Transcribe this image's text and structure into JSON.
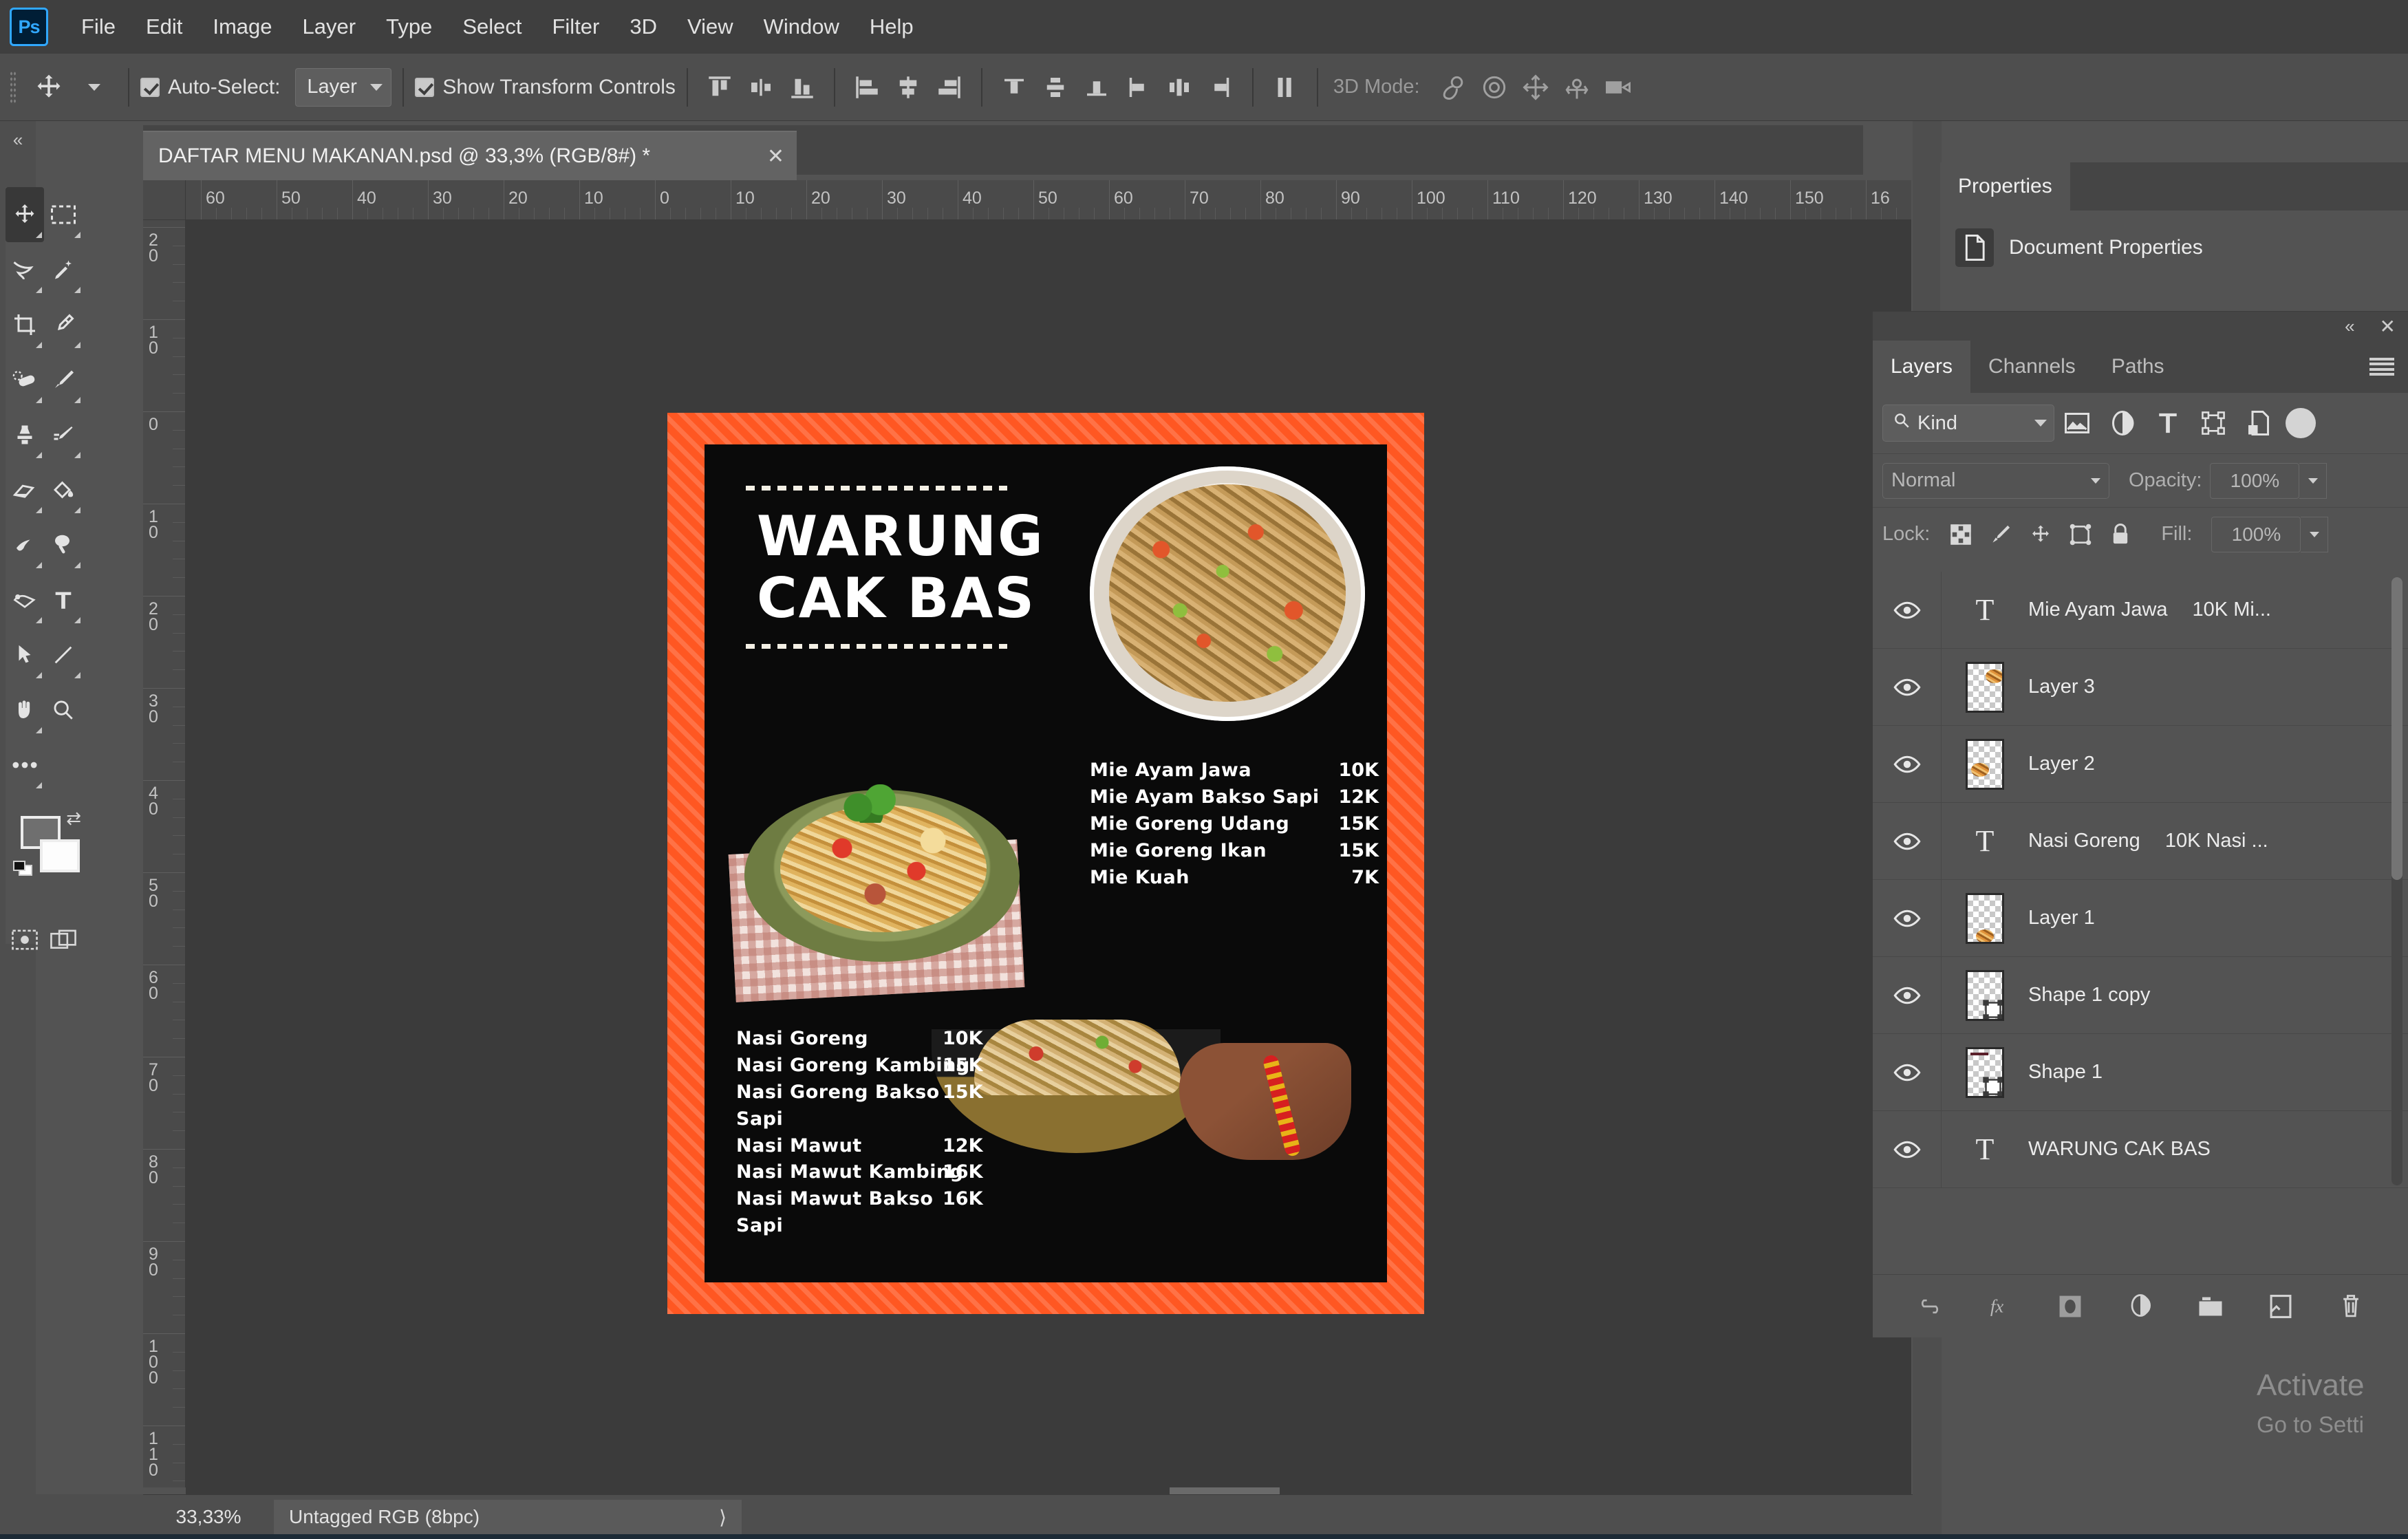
{
  "app": {
    "logo_label": "Ps",
    "menus": [
      "File",
      "Edit",
      "Image",
      "Layer",
      "Type",
      "Select",
      "Filter",
      "3D",
      "View",
      "Window",
      "Help"
    ]
  },
  "options_bar": {
    "auto_select_label": "Auto-Select:",
    "auto_select_checked": true,
    "auto_select_target": "Layer",
    "show_transform_label": "Show Transform Controls",
    "show_transform_checked": true,
    "mode3d_label": "3D Mode:",
    "align_icons": [
      "align-top-edges-icon",
      "align-vertical-centers-icon",
      "align-bottom-edges-icon",
      "align-left-edges-icon",
      "align-horizontal-centers-icon",
      "align-right-edges-icon",
      "distribute-top-edges-icon",
      "distribute-vertical-centers-icon",
      "distribute-bottom-edges-icon",
      "distribute-left-edges-icon",
      "distribute-horizontal-centers-icon",
      "distribute-right-edges-icon",
      "distribute-spacing-icon"
    ],
    "mode3d_icons": [
      "orbit-3d-icon",
      "roll-3d-icon",
      "pan-3d-icon",
      "slide-3d-icon",
      "scale-3d-icon"
    ]
  },
  "document_tab": {
    "title": "DAFTAR MENU MAKANAN.psd @ 33,3% (RGB/8#) *",
    "close_glyph": "✕"
  },
  "rulers": {
    "unit_note": "",
    "horizontal_labels": [
      "60",
      "50",
      "40",
      "30",
      "20",
      "10",
      "0",
      "10",
      "20",
      "30",
      "40",
      "50",
      "60",
      "70",
      "80",
      "90",
      "100",
      "110",
      "120",
      "130",
      "140",
      "150",
      "16"
    ],
    "vertical_labels": [
      "20",
      "10",
      "0",
      "10",
      "20",
      "30",
      "40",
      "50",
      "60",
      "70",
      "80",
      "90",
      "100",
      "110"
    ]
  },
  "toolbar": {
    "tools": [
      {
        "name": "move-tool",
        "glyph": "✛",
        "selected": true
      },
      {
        "name": "rectangular-marquee-tool",
        "glyph": "⬚",
        "selected": false
      },
      {
        "name": "lasso-tool",
        "glyph": "⧉",
        "selected": false
      },
      {
        "name": "quick-selection-tool",
        "glyph": "✨",
        "selected": false
      },
      {
        "name": "crop-tool",
        "glyph": "⬒",
        "selected": false
      },
      {
        "name": "eyedropper-tool",
        "glyph": "✐",
        "selected": false
      },
      {
        "name": "spot-healing-brush-tool",
        "glyph": "⚕",
        "selected": false
      },
      {
        "name": "brush-tool",
        "glyph": "✎",
        "selected": false
      },
      {
        "name": "clone-stamp-tool",
        "glyph": "⚑",
        "selected": false
      },
      {
        "name": "history-brush-tool",
        "glyph": "✒",
        "selected": false
      },
      {
        "name": "eraser-tool",
        "glyph": "▱",
        "selected": false
      },
      {
        "name": "paint-bucket-tool",
        "glyph": "◈",
        "selected": false
      },
      {
        "name": "blur-tool",
        "glyph": "☞",
        "selected": false
      },
      {
        "name": "dodge-tool",
        "glyph": "⚲",
        "selected": false
      },
      {
        "name": "pen-tool",
        "glyph": "✒",
        "selected": false
      },
      {
        "name": "horizontal-type-tool",
        "glyph": "T",
        "selected": false
      },
      {
        "name": "path-selection-tool",
        "glyph": "➤",
        "selected": false
      },
      {
        "name": "line-tool",
        "glyph": "╱",
        "selected": false
      },
      {
        "name": "hand-tool",
        "glyph": "✋",
        "selected": false
      },
      {
        "name": "zoom-tool",
        "glyph": "⚲",
        "selected": false
      },
      {
        "name": "edit-toolbar-tool",
        "glyph": "•••",
        "selected": false
      }
    ],
    "foreground_color": "#6f6f6f",
    "background_color": "#fdfdfd",
    "swap_colors_icon": "swap-colors-icon",
    "default_colors_icon": "default-colors-icon",
    "quick_mask_icon": "quick-mask-mode-icon",
    "screen_mode_icon": "screen-mode-icon"
  },
  "canvas": {
    "poster": {
      "border_color": "#ff5722",
      "background_color": "#0a0a0a",
      "brand_name": "WARUNG\nCAK BAS",
      "mie_items": [
        {
          "name": "Mie Ayam Jawa",
          "price": "10K"
        },
        {
          "name": "Mie Ayam Bakso Sapi",
          "price": "12K"
        },
        {
          "name": "Mie Goreng Udang",
          "price": "15K"
        },
        {
          "name": "Mie Goreng Ikan",
          "price": "15K"
        },
        {
          "name": "Mie Kuah",
          "price": "7K"
        }
      ],
      "nasi_items": [
        {
          "name": "Nasi Goreng",
          "price": "10K"
        },
        {
          "name": "Nasi Goreng Kambing",
          "price": "15K"
        },
        {
          "name": "Nasi Goreng Bakso Sapi",
          "price": "15K"
        },
        {
          "name": "Nasi Mawut",
          "price": "12K"
        },
        {
          "name": "Nasi Mawut Kambing",
          "price": "16K"
        },
        {
          "name": "Nasi Mawut Bakso Sapi",
          "price": "16K"
        }
      ]
    }
  },
  "properties_panel": {
    "tab_label": "Properties",
    "document_properties_label": "Document Properties"
  },
  "layers_panel": {
    "collapse_glyph": "«",
    "close_glyph": "✕",
    "tabs": [
      {
        "label": "Layers",
        "active": true
      },
      {
        "label": "Channels",
        "active": false
      },
      {
        "label": "Paths",
        "active": false
      }
    ],
    "filter_kind_label": "Kind",
    "filter_icons": [
      "filter-pixel-icon",
      "filter-adjustment-icon",
      "filter-type-icon",
      "filter-shape-icon",
      "filter-smart-object-icon"
    ],
    "blend_mode": "Normal",
    "opacity_label": "Opacity:",
    "opacity_value": "100%",
    "lock_label": "Lock:",
    "lock_icons": [
      "lock-transparent-pixels-icon",
      "lock-image-pixels-icon",
      "lock-position-icon",
      "lock-artboard-nesting-icon",
      "lock-all-icon"
    ],
    "fill_label": "Fill:",
    "fill_value": "100%",
    "layers": [
      {
        "name": "Mie Ayam Jawa",
        "name2": "10K Mi...",
        "type": "type",
        "visible": true
      },
      {
        "name": "Layer 3",
        "name2": "",
        "type": "pixel",
        "visible": true
      },
      {
        "name": "Layer 2",
        "name2": "",
        "type": "pixel",
        "visible": true
      },
      {
        "name": "Nasi Goreng",
        "name2": "10K Nasi ...",
        "type": "type",
        "visible": true
      },
      {
        "name": "Layer 1",
        "name2": "",
        "type": "pixel",
        "visible": true
      },
      {
        "name": "Shape 1 copy",
        "name2": "",
        "type": "shape",
        "visible": true
      },
      {
        "name": "Shape 1",
        "name2": "",
        "type": "shape",
        "visible": true
      },
      {
        "name": "WARUNG CAK BAS",
        "name2": "",
        "type": "type",
        "visible": true
      }
    ],
    "bottom_icons": [
      "link-layers-icon",
      "layer-style-fx-icon",
      "add-layer-mask-icon",
      "new-adjustment-layer-icon",
      "new-group-icon",
      "new-layer-icon",
      "delete-layer-icon"
    ]
  },
  "status_bar": {
    "zoom": "33,33%",
    "doc_info": "Untagged RGB (8bpc)",
    "expand_glyph": "⟩"
  },
  "watermark": {
    "title": "Activate",
    "subtitle": "Go to Setti"
  }
}
